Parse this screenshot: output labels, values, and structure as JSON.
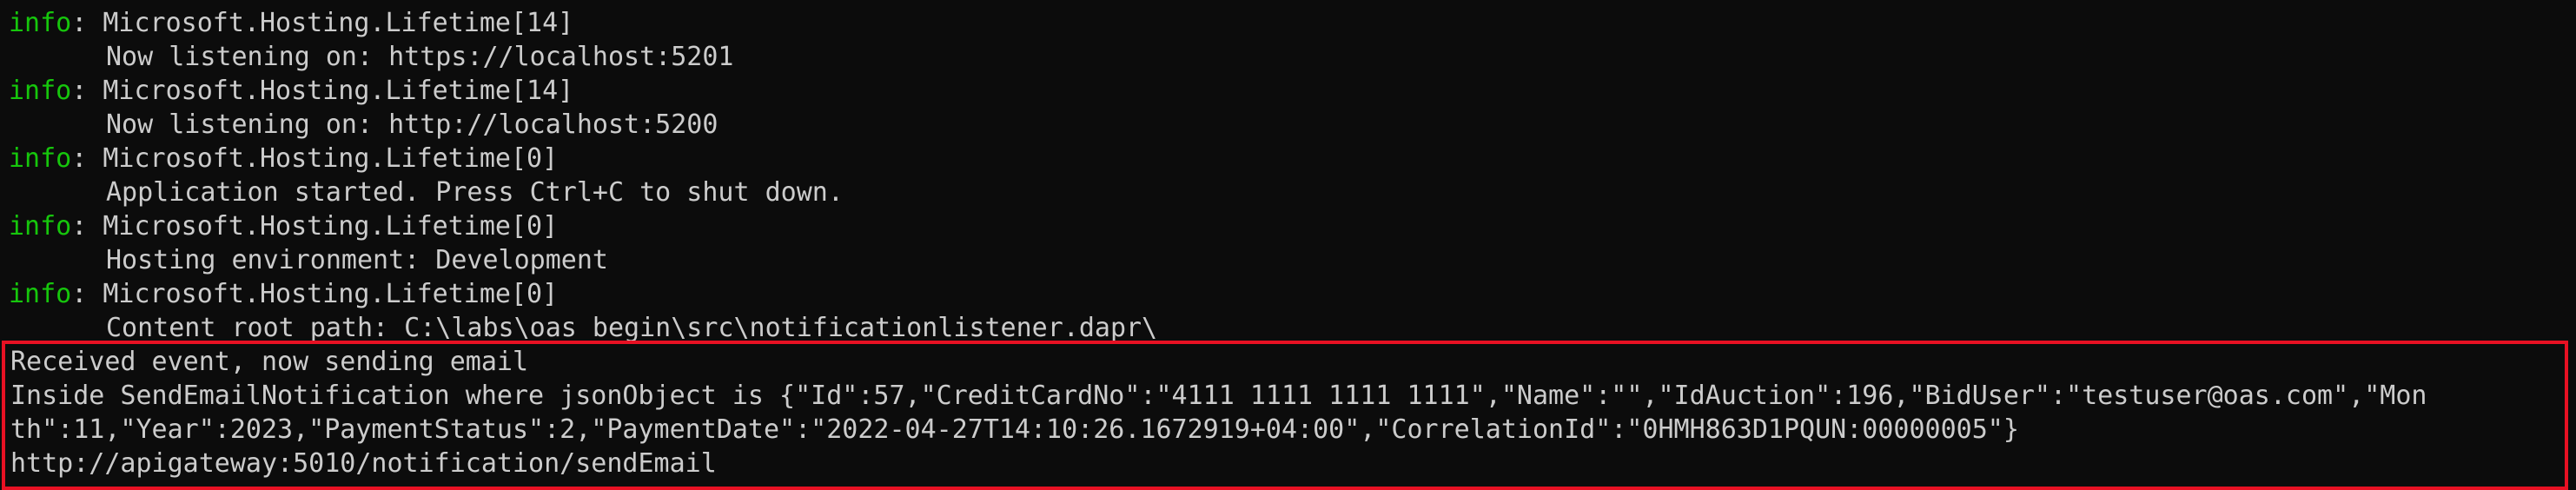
{
  "terminal": {
    "level_color": "#16c60c",
    "text_color": "#cccccc",
    "background": "#0c0c0c",
    "highlight_border_color": "#e81123",
    "log_entries": [
      {
        "level": "info",
        "source": ": Microsoft.Hosting.Lifetime[14]",
        "message": "Now listening on: https://localhost:5201"
      },
      {
        "level": "info",
        "source": ": Microsoft.Hosting.Lifetime[14]",
        "message": "Now listening on: http://localhost:5200"
      },
      {
        "level": "info",
        "source": ": Microsoft.Hosting.Lifetime[0]",
        "message": "Application started. Press Ctrl+C to shut down."
      },
      {
        "level": "info",
        "source": ": Microsoft.Hosting.Lifetime[0]",
        "message": "Hosting environment: Development"
      },
      {
        "level": "info",
        "source": ": Microsoft.Hosting.Lifetime[0]",
        "message": "Content root path: C:\\labs\\oas_begin\\src\\notificationlistener.dapr\\"
      }
    ],
    "highlighted_lines": [
      "Received event, now sending email",
      "Inside SendEmailNotification where jsonObject is {\"Id\":57,\"CreditCardNo\":\"4111 1111 1111 1111\",\"Name\":\"\",\"IdAuction\":196,\"BidUser\":\"testuser@oas.com\",\"Mon",
      "th\":11,\"Year\":2023,\"PaymentStatus\":2,\"PaymentDate\":\"2022-04-27T14:10:26.1672919+04:00\",\"CorrelationId\":\"0HMH863D1PQUN:00000005\"}",
      "http://apigateway:5010/notification/sendEmail"
    ]
  }
}
